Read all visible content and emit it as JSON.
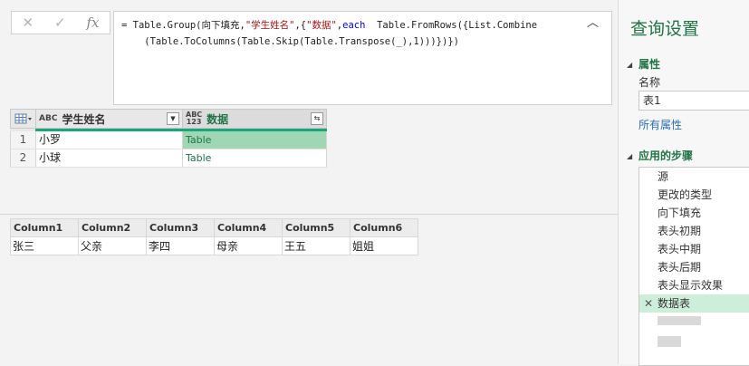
{
  "toolbar": {
    "cancel_icon": "✕",
    "commit_icon": "✓",
    "fx_label": "fx",
    "formula_line1_a": "= Table.Group(向下填充,",
    "formula_line1_str1": "\"学生姓名\"",
    "formula_line1_b": ",{",
    "formula_line1_str2": "\"数据\"",
    "formula_line1_c": ",",
    "formula_line1_kw": "each",
    "formula_line1_d": "  Table.FromRows({List.Combine",
    "formula_line2": "    (Table.ToColumns(Table.Skip(Table.Transpose(_),1)))})})",
    "collapse_icon": "︿"
  },
  "grid1": {
    "headers": {
      "name": "学生姓名",
      "name_type": "ABC",
      "data": "数据",
      "data_type_top": "ABC",
      "data_type_bottom": "123"
    },
    "rows": [
      {
        "index": "1",
        "name": "小罗",
        "data": "Table"
      },
      {
        "index": "2",
        "name": "小球",
        "data": "Table"
      }
    ]
  },
  "grid2": {
    "headers": [
      "Column1",
      "Column2",
      "Column3",
      "Column4",
      "Column5",
      "Column6"
    ],
    "row": [
      "张三",
      "父亲",
      "李四",
      "母亲",
      "王五",
      "姐姐"
    ]
  },
  "pane": {
    "title": "查询设置",
    "properties_label": "属性",
    "name_label": "名称",
    "name_value": "表1",
    "all_properties": "所有属性",
    "steps_label": "应用的步骤",
    "steps": [
      "源",
      "更改的类型",
      "向下填充",
      "表头初期",
      "表头中期",
      "表头后期",
      "表头显示效果",
      "数据表"
    ]
  },
  "colors": {
    "accent_green": "#217346",
    "selection_green": "#9fd7b5",
    "active_step": "#cdeedb",
    "link_blue": "#2a6fb3"
  }
}
